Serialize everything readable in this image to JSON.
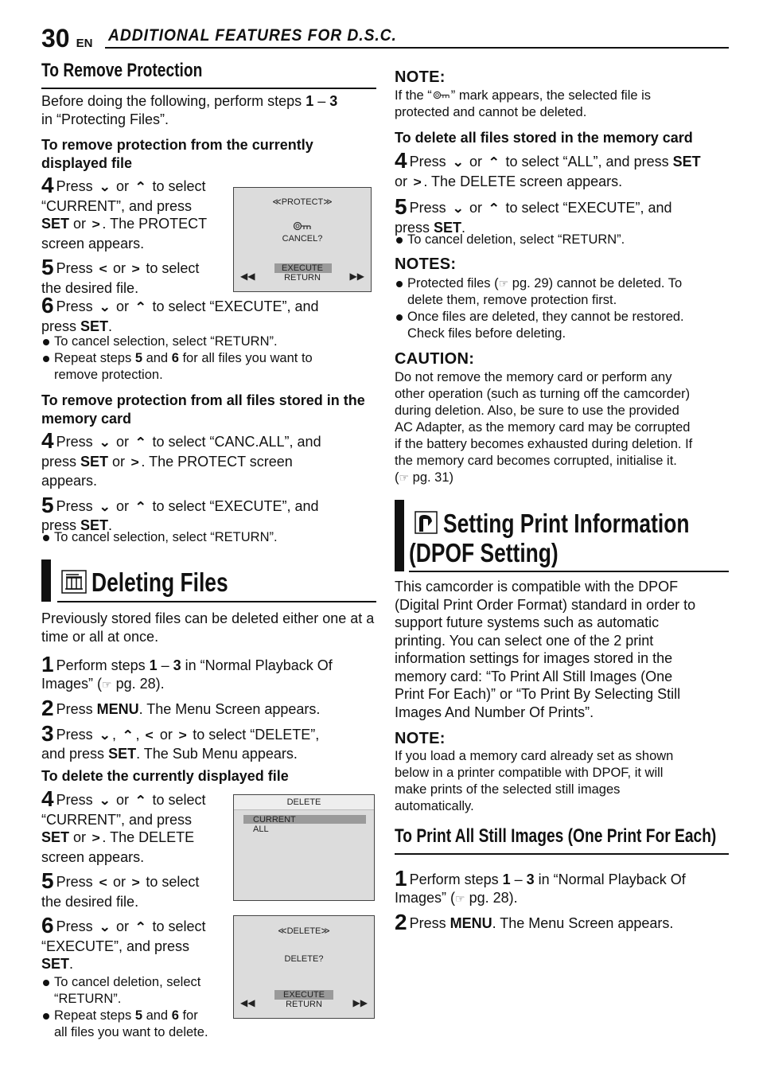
{
  "header": {
    "page_number": "30",
    "lang": "EN",
    "title": "ADDITIONAL FEATURES FOR D.S.C."
  },
  "remove_protection": {
    "title": "To Remove Protection",
    "intro_a": "Before doing the following, perform steps ",
    "intro_b": "1",
    "intro_c": " – ",
    "intro_d": "3",
    "intro_e": "in “Protecting Files”.",
    "current": {
      "heading": "To remove protection from the currently displayed file",
      "s4_num": "4",
      "s4_a": "Press",
      "s4_b": "or",
      "s4_c": "to select",
      "s4_d": "“CURRENT”, and press",
      "s4_e": "SET",
      "s4_f": "or",
      "s4_g": ". The PROTECT",
      "s4_h": "screen appears.",
      "s5_num": "5",
      "s5_a": "Press",
      "s5_b": "or",
      "s5_c": "to select",
      "s5_d": "the desired file.",
      "s6_num": "6",
      "s6_a": "Press",
      "s6_b": "or",
      "s6_c": "to select “EXECUTE”, and",
      "s6_d": "press ",
      "s6_e": "SET",
      "s6_f": ".",
      "b1": "To cancel selection, select “RETURN”.",
      "b2_a": "Repeat steps ",
      "b2_b": "5",
      "b2_c": " and ",
      "b2_d": "6",
      "b2_e": " for all files you want to",
      "b2_f": "remove protection."
    },
    "all": {
      "heading": "To remove protection from all files stored in the memory card",
      "s4_num": "4",
      "s4_a": "Press",
      "s4_b": "or",
      "s4_c": "to select “CANC.ALL”, and",
      "s4_d": "press ",
      "s4_e": "SET",
      "s4_f": " or",
      "s4_g": ". The PROTECT screen",
      "s4_h": "appears.",
      "s5_num": "5",
      "s5_a": "Press",
      "s5_b": "or",
      "s5_c": "to select “EXECUTE”, and",
      "s5_d": "press ",
      "s5_e": "SET",
      "s5_f": ".",
      "b1": "To cancel selection, select “RETURN”."
    },
    "screen": {
      "title": "≪PROTECT≫",
      "icon": "key-icon",
      "prompt": "CANCEL?",
      "options": [
        "EXECUTE",
        "RETURN"
      ],
      "selected": "EXECUTE"
    }
  },
  "deleting_files": {
    "title": "Deleting Files",
    "icon": "trash-icon",
    "intro": "Previously stored files can be deleted either one at a time or all at once.",
    "s1_num": "1",
    "s1_a": "Perform steps ",
    "s1_b": "1",
    "s1_c": " – ",
    "s1_d": "3",
    "s1_e": " in “Normal Playback Of",
    "s1_f": "Images” (",
    "s1_g": "☞",
    "s1_h": " pg. 28).",
    "s2_num": "2",
    "s2_a": "Press ",
    "s2_b": "MENU",
    "s2_c": ". The Menu Screen appears.",
    "s3_num": "3",
    "s3_a": "Press",
    "s3_b": ",",
    "s3_c": ",",
    "s3_d": "or",
    "s3_e": "to select “DELETE”,",
    "s3_f": "and press ",
    "s3_g": "SET",
    "s3_h": ". The Sub Menu appears.",
    "current": {
      "heading": "To delete the currently displayed file",
      "s4_num": "4",
      "s4_a": "Press",
      "s4_b": "or",
      "s4_c": "to select",
      "s4_d": "“CURRENT”, and press",
      "s4_e": "SET",
      "s4_f": " or",
      "s4_g": ". The DELETE",
      "s4_h": "screen appears.",
      "s5_num": "5",
      "s5_a": "Press",
      "s5_b": "or",
      "s5_c": "to select",
      "s5_d": "the desired file.",
      "s6_num": "6",
      "s6_a": "Press",
      "s6_b": "or",
      "s6_c": "to select",
      "s6_d": "“EXECUTE”, and press",
      "s6_e": "SET",
      "s6_f": ".",
      "b1_a": "To cancel deletion, select",
      "b1_b": "“RETURN”.",
      "b2_a": "Repeat steps ",
      "b2_b": "5",
      "b2_c": " and ",
      "b2_d": "6",
      "b2_e": " for",
      "b2_f": "all files you want to delete."
    },
    "menu_screen": {
      "title": "DELETE",
      "items": [
        "CURRENT",
        "ALL"
      ],
      "selected": "CURRENT"
    },
    "confirm_screen": {
      "title": "≪DELETE≫",
      "prompt": "DELETE?",
      "options": [
        "EXECUTE",
        "RETURN"
      ],
      "selected": "EXECUTE"
    }
  },
  "right_column": {
    "note1": {
      "heading": "NOTE:",
      "text_a": "If the “",
      "text_b": "” mark appears, the selected file is",
      "text_c": "protected and cannot be deleted."
    },
    "delete_all": {
      "heading": "To delete all files stored in the memory card",
      "s4_num": "4",
      "s4_a": "Press",
      "s4_b": "or",
      "s4_c": "to select “ALL”, and press ",
      "s4_d": "SET",
      "s4_e": "or",
      "s4_f": ". The DELETE screen appears.",
      "s5_num": "5",
      "s5_a": "Press",
      "s5_b": "or",
      "s5_c": "to select “EXECUTE”, and",
      "s5_d": "press ",
      "s5_e": "SET",
      "s5_f": ".",
      "b1": "To cancel deletion, select “RETURN”."
    },
    "notes": {
      "heading": "NOTES:",
      "b1_a": "Protected files (",
      "b1_b": "☞",
      "b1_c": " pg. 29) cannot be deleted. To",
      "b1_d": "delete them, remove protection first.",
      "b2_a": "Once files are deleted, they cannot be restored.",
      "b2_b": "Check files before deleting."
    },
    "caution": {
      "heading": "CAUTION:",
      "lines": [
        "Do not remove the memory card or perform any",
        "other operation (such as turning off the camcorder)",
        "during deletion. Also, be sure to use the provided",
        "AC Adapter, as the memory card may be corrupted",
        "if the battery becomes exhausted during deletion. If",
        "the memory card becomes corrupted, initialise it."
      ],
      "ref_a": "(",
      "ref_b": "☞",
      "ref_c": " pg. 31)"
    },
    "dpof": {
      "title_line1": "Setting Print Information",
      "title_line2": "(DPOF Setting)",
      "icon": "print-icon",
      "intro_lines": [
        "This camcorder is compatible with the DPOF",
        "(Digital Print Order Format) standard in order to",
        "support future systems such as automatic",
        "printing. You can select one of the 2 print",
        "information settings for images stored in the",
        "memory card: “To Print All Still Images (One",
        "Print For Each)” or “To Print By Selecting Still",
        "Images And Number Of Prints”."
      ],
      "note_heading": "NOTE:",
      "note_lines": [
        "If you load a memory card already set as shown",
        "below in a printer compatible with DPOF, it will",
        "make prints of the selected still images",
        "automatically."
      ],
      "sub_title": "To Print All Still Images (One Print For Each)",
      "s1_num": "1",
      "s1_a": "Perform steps ",
      "s1_b": "1",
      "s1_c": " – ",
      "s1_d": "3",
      "s1_e": " in “Normal Playback Of",
      "s1_f": "Images” (",
      "s1_g": "☞",
      "s1_h": " pg. 28).",
      "s2_num": "2",
      "s2_a": "Press ",
      "s2_b": "MENU",
      "s2_c": ". The Menu Screen appears."
    }
  }
}
